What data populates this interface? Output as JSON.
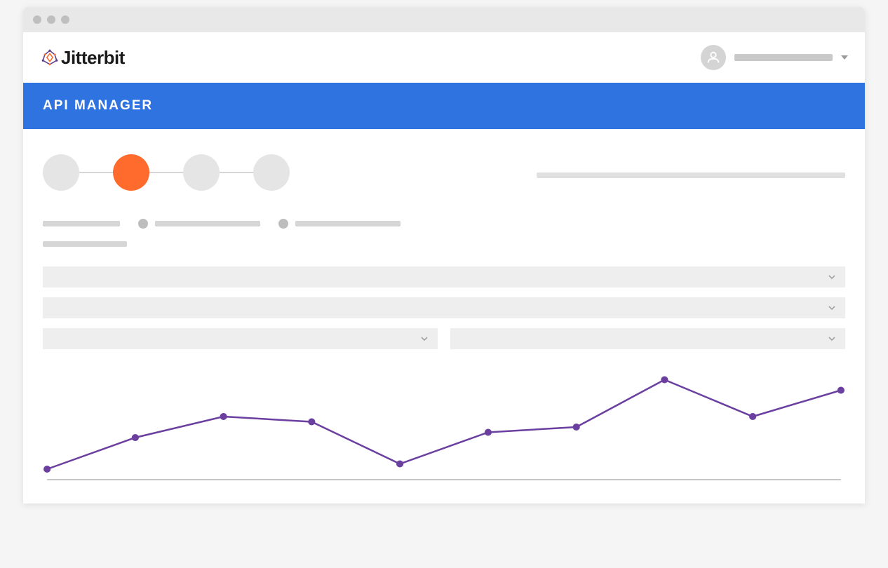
{
  "brand": {
    "name": "Jitterbit"
  },
  "header": {
    "page_title": "API MANAGER"
  },
  "user": {
    "menu_caret": "▾"
  },
  "stepper": {
    "steps": [
      {
        "active": false
      },
      {
        "active": true
      },
      {
        "active": false
      },
      {
        "active": false
      }
    ]
  },
  "colors": {
    "brand_blue": "#2f73e0",
    "accent_orange": "#ff6b2c",
    "chart_purple": "#6b3fa0"
  },
  "chart_data": {
    "type": "line",
    "title": "",
    "xlabel": "",
    "ylabel": "",
    "x": [
      0,
      1,
      2,
      3,
      4,
      5,
      6,
      7,
      8,
      9
    ],
    "values": [
      10,
      40,
      60,
      55,
      15,
      45,
      50,
      95,
      60,
      85
    ],
    "ylim": [
      0,
      100
    ]
  }
}
